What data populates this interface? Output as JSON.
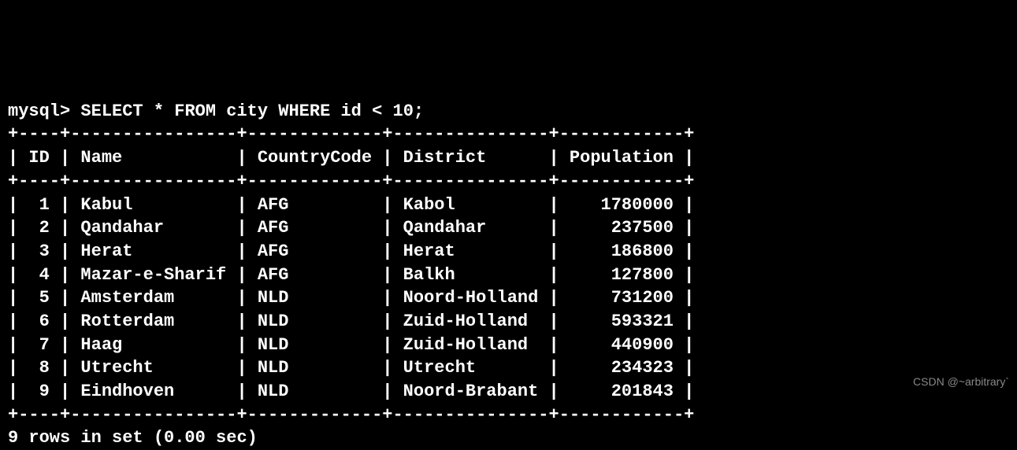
{
  "prompt": "mysql>",
  "query": "SELECT * FROM city WHERE id < 10;",
  "border_top": "+----+----------------+-------------+---------------+------------+",
  "header_line": "| ID | Name           | CountryCode | District      | Population |",
  "border_mid": "+----+----------------+-------------+---------------+------------+",
  "rows": [
    "|  1 | Kabul          | AFG         | Kabol         |    1780000 |",
    "|  2 | Qandahar       | AFG         | Qandahar      |     237500 |",
    "|  3 | Herat          | AFG         | Herat         |     186800 |",
    "|  4 | Mazar-e-Sharif | AFG         | Balkh         |     127800 |",
    "|  5 | Amsterdam      | NLD         | Noord-Holland |     731200 |",
    "|  6 | Rotterdam      | NLD         | Zuid-Holland  |     593321 |",
    "|  7 | Haag           | NLD         | Zuid-Holland  |     440900 |",
    "|  8 | Utrecht        | NLD         | Utrecht       |     234323 |",
    "|  9 | Eindhoven      | NLD         | Noord-Brabant |     201843 |"
  ],
  "border_bot": "+----+----------------+-------------+---------------+------------+",
  "summary": "9 rows in set (0.00 sec)",
  "watermark": "CSDN @~arbitrary`",
  "chart_data": {
    "type": "table",
    "columns": [
      "ID",
      "Name",
      "CountryCode",
      "District",
      "Population"
    ],
    "data": [
      [
        1,
        "Kabul",
        "AFG",
        "Kabol",
        1780000
      ],
      [
        2,
        "Qandahar",
        "AFG",
        "Qandahar",
        237500
      ],
      [
        3,
        "Herat",
        "AFG",
        "Herat",
        186800
      ],
      [
        4,
        "Mazar-e-Sharif",
        "AFG",
        "Balkh",
        127800
      ],
      [
        5,
        "Amsterdam",
        "NLD",
        "Noord-Holland",
        731200
      ],
      [
        6,
        "Rotterdam",
        "NLD",
        "Zuid-Holland",
        593321
      ],
      [
        7,
        "Haag",
        "NLD",
        "Zuid-Holland",
        440900
      ],
      [
        8,
        "Utrecht",
        "NLD",
        "Utrecht",
        234323
      ],
      [
        9,
        "Eindhoven",
        "NLD",
        "Noord-Brabant",
        201843
      ]
    ]
  }
}
